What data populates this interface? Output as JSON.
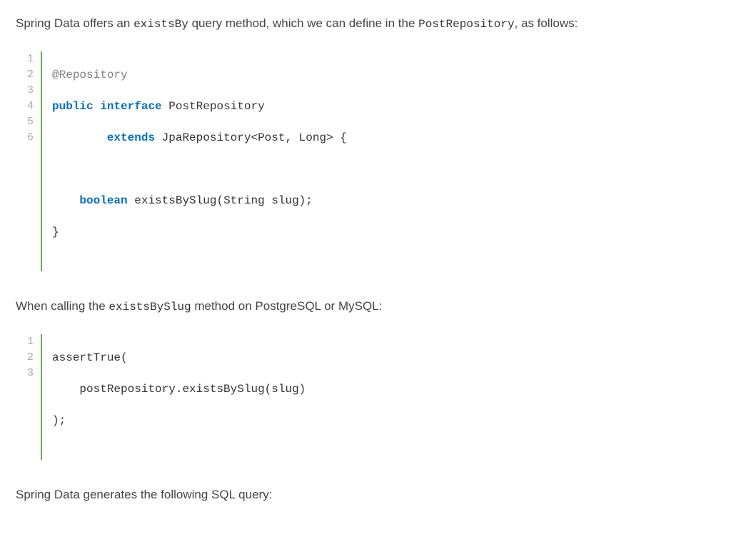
{
  "para1": {
    "pre": "Spring Data offers an ",
    "c1": "existsBy",
    "mid": " query method, which we can define in the ",
    "c2": "PostRepository",
    "post": ", as follows:"
  },
  "code1": {
    "ln": [
      "1",
      "2",
      "3",
      "4",
      "5",
      "6"
    ],
    "l1": {
      "t1": "@Repository"
    },
    "l2": {
      "t1": "public",
      "t2": " ",
      "t3": "interface",
      "t4": " PostRepository"
    },
    "l3": {
      "t1": "        ",
      "t2": "extends",
      "t3": " JpaRepository<Post, Long> {"
    },
    "l4": {
      "t1": " "
    },
    "l5": {
      "t1": "    ",
      "t2": "boolean",
      "t3": " existsBySlug(String slug);"
    },
    "l6": {
      "t1": "}"
    }
  },
  "para2": {
    "pre": "When calling the ",
    "c1": "existsBySlug",
    "post": " method on PostgreSQL or MySQL:"
  },
  "code2": {
    "ln": [
      "1",
      "2",
      "3"
    ],
    "l1": {
      "t1": "assertTrue("
    },
    "l2": {
      "t1": "    postRepository.existsBySlug(slug)"
    },
    "l3": {
      "t1": ");"
    }
  },
  "para3": {
    "pre": "Spring Data generates the following SQL query:"
  }
}
